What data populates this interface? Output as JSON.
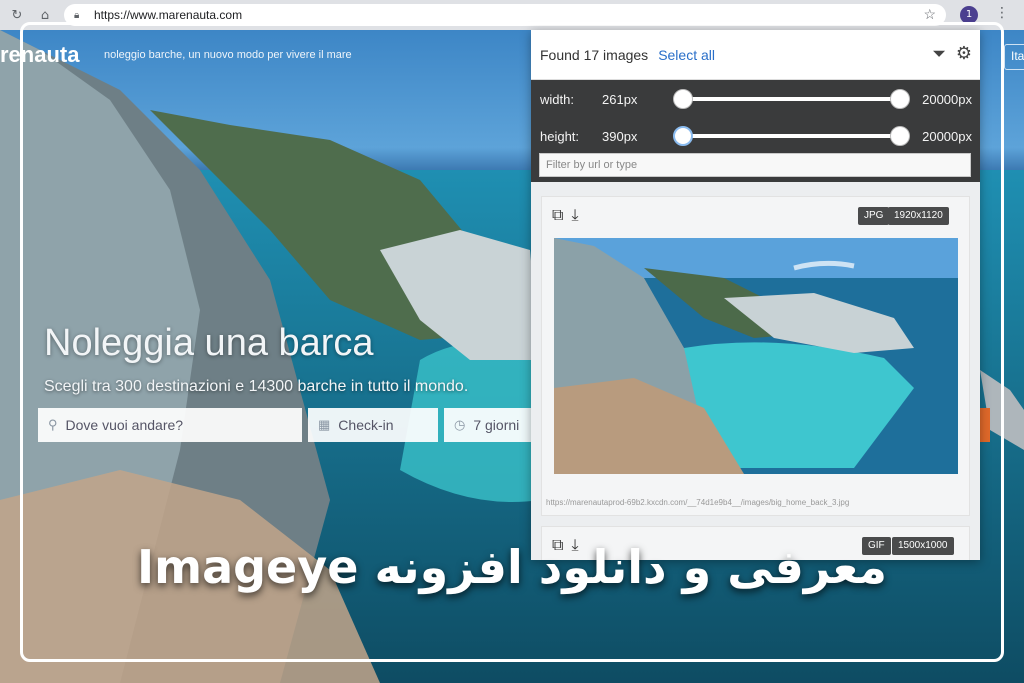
{
  "browser": {
    "url": "https://www.marenauta.com",
    "ext_badge": "1"
  },
  "site": {
    "brand": "renauta",
    "tagline": "noleggio barche, un nuovo modo per vivere il mare",
    "lang_button": "Ita",
    "hero_title": "Noleggia una barca",
    "hero_subtitle": "Scegli tra 300 destinazioni e 14300 barche in tutto il mondo.",
    "search": {
      "destination_placeholder": "Dove vuoi andare?",
      "checkin_placeholder": "Check-in",
      "duration_value": "7 giorni"
    }
  },
  "popup": {
    "found_text": "Found 17 images",
    "select_all": "Select all",
    "width_label": "width:",
    "width_min": "261px",
    "width_max": "20000px",
    "height_label": "height:",
    "height_min": "390px",
    "height_max": "20000px",
    "filter_placeholder": "Filter by url or type",
    "cards": [
      {
        "type": "JPG",
        "dimensions": "1920x1120",
        "url": "https://marenautaprod-69b2.kxcdn.com/__74d1e9b4__/images/big_home_back_3.jpg"
      },
      {
        "type": "GIF",
        "dimensions": "1500x1000"
      }
    ]
  },
  "banner": {
    "text": "معرفی و دانلود افزونه Imageye"
  }
}
